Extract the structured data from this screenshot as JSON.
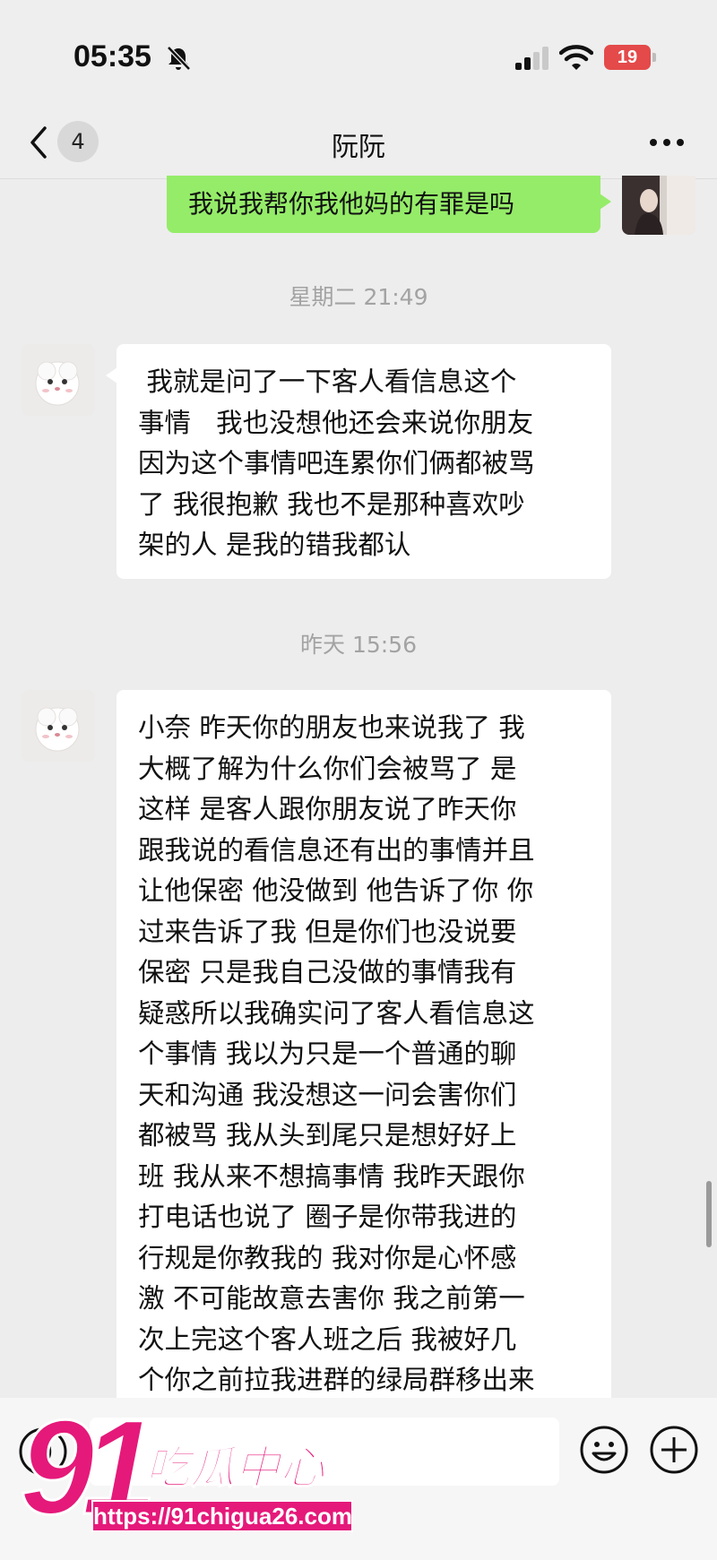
{
  "status_bar": {
    "time": "05:35",
    "battery": "19",
    "icons": [
      "bell-off-icon",
      "signal-icon",
      "wifi-icon",
      "battery-icon"
    ]
  },
  "nav": {
    "back_icon": "chevron-left-icon",
    "unread_count": "4",
    "title": "阮阮",
    "more_icon": "ellipsis-icon"
  },
  "messages": [
    {
      "type": "outgoing",
      "text": "我说我帮你我他妈的有罪是吗"
    },
    {
      "type": "timestamp",
      "text": "星期二 21:49"
    },
    {
      "type": "incoming",
      "text": " 我就是问了一下客人看信息这个\n事情   我也没想他还会来说你朋友\n因为这个事情吧连累你们俩都被骂\n了 我很抱歉 我也不是那种喜欢吵\n架的人 是我的错我都认"
    },
    {
      "type": "timestamp",
      "text": "昨天 15:56"
    },
    {
      "type": "incoming",
      "text": "小奈 昨天你的朋友也来说我了 我\n大概了解为什么你们会被骂了 是\n这样 是客人跟你朋友说了昨天你\n跟我说的看信息还有出的事情并且\n让他保密 他没做到 他告诉了你 你\n过来告诉了我 但是你们也没说要\n保密 只是我自己没做的事情我有\n疑惑所以我确实问了客人看信息这\n个事情 我以为只是一个普通的聊\n天和沟通 我没想这一问会害你们\n都被骂 我从头到尾只是想好好上\n班 我从来不想搞事情 我昨天跟你\n打电话也说了 圈子是你带我进的\n行规是你教我的 我对你是心怀感\n激 不可能故意去害你 我之前第一\n次上完这个客人班之后 我被好几\n个你之前拉我进群的绿局群移出来"
    }
  ],
  "input_bar": {
    "placeholder": "",
    "icons": [
      "voice-icon",
      "emoji-icon",
      "plus-icon"
    ]
  },
  "watermark": {
    "number": "91",
    "name": "吃瓜中心",
    "url": "https://91chigua26.com"
  },
  "colors": {
    "outgoing_bubble": "#95ec69",
    "incoming_bubble": "#ffffff",
    "background": "#ededed",
    "watermark": "#e5197a",
    "battery": "#e44a4a"
  }
}
